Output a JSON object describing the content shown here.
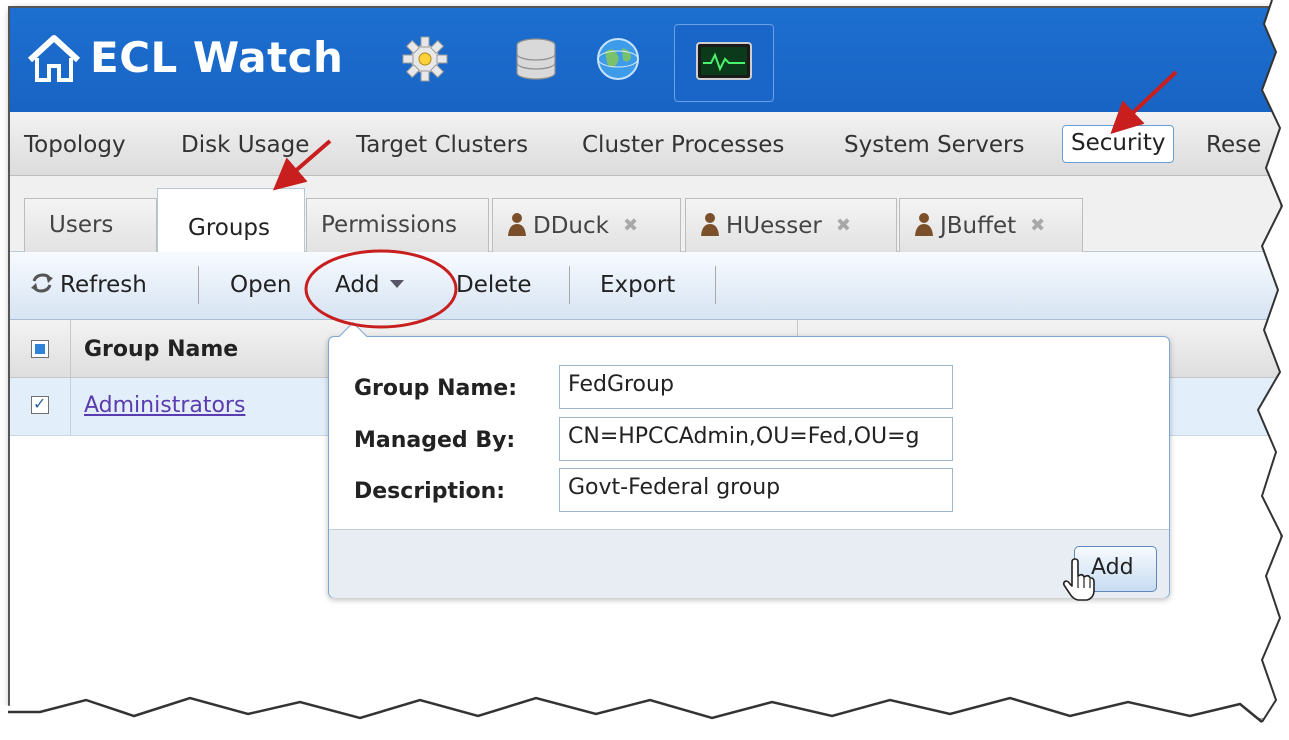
{
  "header": {
    "title": "ECL Watch",
    "icons": [
      "home-icon",
      "gear-icon",
      "database-icon",
      "globe-icon",
      "monitor-icon"
    ]
  },
  "main_nav": {
    "items": [
      "Topology",
      "Disk Usage",
      "Target Clusters",
      "Cluster Processes",
      "System Servers",
      "Security",
      "Rese"
    ],
    "active": "Security"
  },
  "sub_tabs": {
    "items": [
      {
        "label": "Users"
      },
      {
        "label": "Groups",
        "active": true
      },
      {
        "label": "Permissions"
      },
      {
        "label": "DDuck",
        "closable": true
      },
      {
        "label": "HUesser",
        "closable": true
      },
      {
        "label": "JBuffet",
        "closable": true
      }
    ]
  },
  "toolbar": {
    "refresh": "Refresh",
    "open": "Open",
    "add": "Add",
    "delete": "Delete",
    "export": "Export"
  },
  "grid": {
    "columns": [
      "Group Name"
    ],
    "rows": [
      {
        "group_name": "Administrators",
        "checked": true
      }
    ]
  },
  "popup": {
    "fields": [
      {
        "label": "Group Name:",
        "value": "FedGroup"
      },
      {
        "label": "Managed By:",
        "value": "CN=HPCCAdmin,OU=Fed,OU=g"
      },
      {
        "label": "Description:",
        "value": "Govt-Federal group"
      }
    ],
    "submit": "Add"
  },
  "colors": {
    "header_blue": "#1d6fd0",
    "annotation_red": "#c81e1e",
    "link_purple": "#5b3cb0"
  }
}
